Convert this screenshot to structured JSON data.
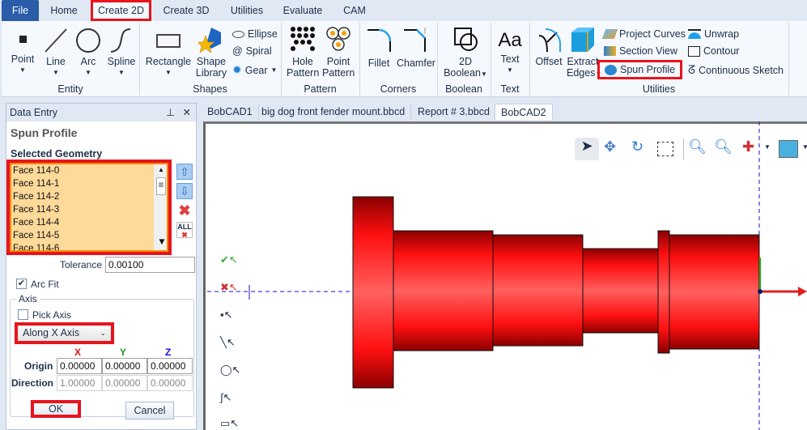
{
  "ribbon_tabs": [
    "File",
    "Home",
    "Create 2D",
    "Create 3D",
    "Utilities",
    "Evaluate",
    "CAM"
  ],
  "active_tab": "Create 2D",
  "groups": {
    "entity": {
      "label": "Entity",
      "items": [
        "Point",
        "Line",
        "Arc",
        "Spline"
      ]
    },
    "shapes": {
      "label": "Shapes",
      "rectangle": "Rectangle",
      "shape_library": [
        "Shape",
        "Library"
      ],
      "ellipse": "Ellipse",
      "spiral": "Spiral",
      "gear": "Gear"
    },
    "pattern": {
      "label": "Pattern",
      "hole": [
        "Hole",
        "Pattern"
      ],
      "point": [
        "Point",
        "Pattern"
      ]
    },
    "corners": {
      "label": "Corners",
      "fillet": "Fillet",
      "chamfer": "Chamfer"
    },
    "boolean": {
      "label": "Boolean",
      "btn": [
        "2D",
        "Boolean"
      ]
    },
    "text": {
      "label": "Text",
      "btn": "Text"
    },
    "utilities": {
      "label": "Utilities",
      "offset": "Offset",
      "extract": [
        "Extract",
        "Edges"
      ],
      "project_curves": "Project Curves",
      "section_view": "Section View",
      "spun_profile": "Spun Profile",
      "unwrap": "Unwrap",
      "contour": "Contour",
      "continuous_sketch": "Continuous Sketch"
    }
  },
  "panel": {
    "title": "Data Entry",
    "heading": "Spun Profile",
    "selected_label": "Selected Geometry",
    "faces": [
      "Face 114-0",
      "Face 114-1",
      "Face 114-2",
      "Face 114-3",
      "Face 114-4",
      "Face 114-5",
      "Face 114-6"
    ],
    "all_label": "ALL",
    "tolerance_label": "Tolerance",
    "tolerance": "0.00100",
    "arc_fit": "Arc Fit",
    "arc_fit_checked": true,
    "axis_label": "Axis",
    "pick_axis": "Pick Axis",
    "pick_axis_checked": false,
    "axis_select": "Along X Axis",
    "x": "X",
    "y": "Y",
    "z": "Z",
    "origin_label": "Origin",
    "origin": [
      "0.00000",
      "0.00000",
      "0.00000"
    ],
    "direction_label": "Direction",
    "direction": [
      "1.00000",
      "0.00000",
      "0.00000"
    ],
    "ok": "OK",
    "cancel": "Cancel"
  },
  "doc_tabs": [
    "BobCAD1",
    "big dog front fender mount.bbcd",
    "Report # 3.bbcd",
    "BobCAD2"
  ],
  "active_doc": "BobCAD2",
  "colors": {
    "highlight": "#e8141c",
    "part": "#ff1a1a",
    "file_tab": "#2a5ca8"
  }
}
